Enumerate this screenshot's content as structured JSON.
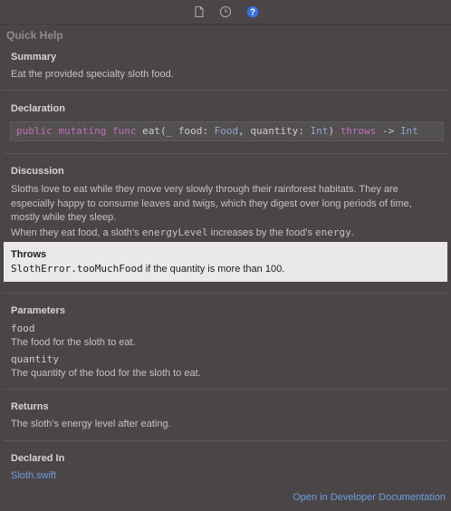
{
  "toolbar": {
    "icons": [
      "file-inspector-icon",
      "history-inspector-icon",
      "quick-help-icon"
    ],
    "active_color": "#3a6fe0"
  },
  "panel_title": "Quick Help",
  "summary": {
    "heading": "Summary",
    "text": "Eat the provided specialty sloth food."
  },
  "declaration": {
    "heading": "Declaration",
    "tokens": [
      {
        "t": "public",
        "k": "kw"
      },
      {
        "t": " ",
        "k": "pl"
      },
      {
        "t": "mutating",
        "k": "kw"
      },
      {
        "t": " ",
        "k": "pl"
      },
      {
        "t": "func",
        "k": "kw"
      },
      {
        "t": " eat(_ food: ",
        "k": "pl"
      },
      {
        "t": "Food",
        "k": "ty"
      },
      {
        "t": ", quantity: ",
        "k": "pl"
      },
      {
        "t": "Int",
        "k": "ty"
      },
      {
        "t": ") ",
        "k": "pl"
      },
      {
        "t": "throws",
        "k": "kw"
      },
      {
        "t": " -> ",
        "k": "pl"
      },
      {
        "t": "Int",
        "k": "ty"
      }
    ]
  },
  "discussion": {
    "heading": "Discussion",
    "line1": "Sloths love to eat while they move very slowly through their rainforest habitats. They are",
    "line2": "especially happy to consume leaves and twigs, which they digest over long periods of time,",
    "line3": "mostly while they sleep.",
    "para2_a": "When they eat food, a sloth’s ",
    "para2_code1": "energyLevel",
    "para2_b": " increases by the food’s ",
    "para2_code2": "energy",
    "para2_c": "."
  },
  "throws": {
    "heading": "Throws",
    "code": "SlothError.tooMuchFood",
    "text": " if the quantity is more than 100."
  },
  "parameters": {
    "heading": "Parameters",
    "items": [
      {
        "name": "food",
        "desc": "The food for the sloth to eat."
      },
      {
        "name": "quantity",
        "desc": "The quantity of the food for the sloth to eat."
      }
    ]
  },
  "returns": {
    "heading": "Returns",
    "text": "The sloth’s energy level after eating."
  },
  "declared_in": {
    "heading": "Declared In",
    "file": "Sloth.swift"
  },
  "footer_link": "Open in Developer Documentation"
}
